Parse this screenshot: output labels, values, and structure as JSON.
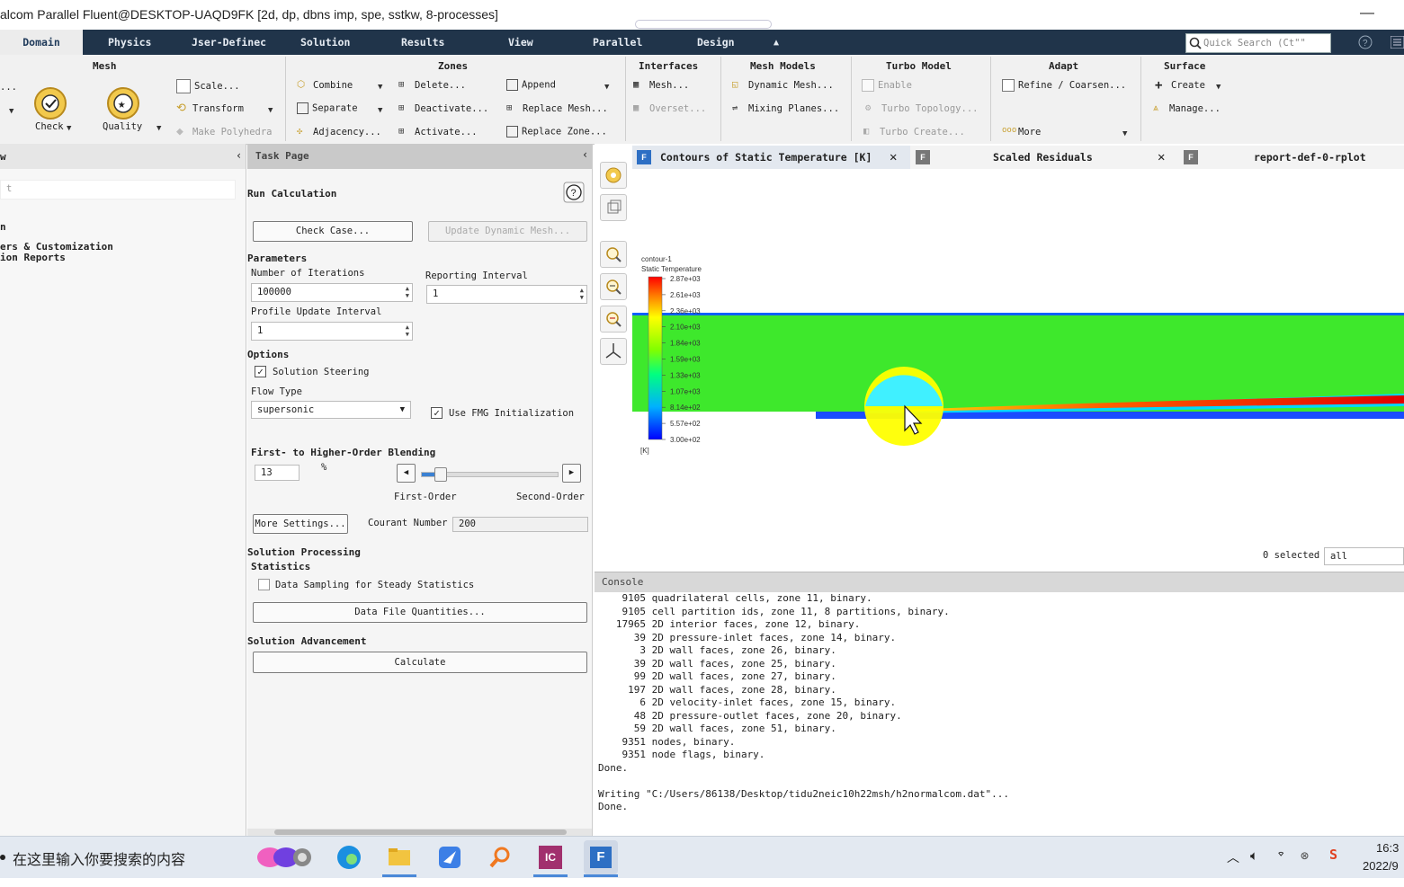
{
  "window": {
    "title": "alcom Parallel Fluent@DESKTOP-UAQD9FK  [2d, dp, dbns imp, spe, sstkw, 8-processes]",
    "minimize": "—"
  },
  "ribbon_tabs": [
    "Domain",
    "Physics",
    "Jser-Definec",
    "Solution",
    "Results",
    "View",
    "Parallel",
    "Design"
  ],
  "ribbon_collapse": "▲",
  "quick_search": {
    "placeholder": "Quick Search (Ct\"\""
  },
  "ribbon": {
    "mesh": {
      "title": "Mesh",
      "dots": "...",
      "check": "Check",
      "quality": "Quality",
      "scale": "Scale...",
      "transform": "Transform",
      "make_polyhedra": "Make Polyhedra"
    },
    "zones": {
      "title": "Zones",
      "combine": "Combine",
      "separate": "Separate",
      "adjacency": "Adjacency...",
      "delete": "Delete...",
      "deactivate": "Deactivate...",
      "activate": "Activate...",
      "append": "Append",
      "replace_mesh": "Replace Mesh...",
      "replace_zone": "Replace Zone..."
    },
    "interfaces": {
      "title": "Interfaces",
      "mesh": "Mesh...",
      "overset": "Overset..."
    },
    "mesh_models": {
      "title": "Mesh Models",
      "dynamic_mesh": "Dynamic Mesh...",
      "mixing_planes": "Mixing Planes..."
    },
    "turbo_model": {
      "title": "Turbo Model",
      "enable": "Enable",
      "turbo_topology": "Turbo Topology...",
      "turbo_create": "Turbo Create..."
    },
    "adapt": {
      "title": "Adapt",
      "refine": "Refine / Coarsen...",
      "more": "More"
    },
    "surface": {
      "title": "Surface",
      "create": "Create",
      "manage": "Manage..."
    }
  },
  "tree": {
    "header": "w",
    "filter": "t",
    "items": [
      "n",
      "ers & Customization",
      "ion Reports"
    ]
  },
  "task_page": {
    "header": "Task Page",
    "title": "Run Calculation",
    "check_case": "Check Case...",
    "update_dynamic_mesh": "Update Dynamic Mesh...",
    "parameters": "Parameters",
    "num_iterations_label": "Number of Iterations",
    "num_iterations": "100000",
    "reporting_interval_label": "Reporting Interval",
    "reporting_interval": "1",
    "profile_update_label": "Profile Update Interval",
    "profile_update": "1",
    "options": "Options",
    "solution_steering": "Solution Steering",
    "flow_type_label": "Flow Type",
    "flow_type": "supersonic",
    "use_fmg": "Use FMG Initialization",
    "blending_label": "First- to Higher-Order Blending",
    "blending_value": "13",
    "blending_percent": "%",
    "blending_fraction": 0.13,
    "first_order": "First-Order",
    "second_order": "Second-Order",
    "more_settings": "More Settings...",
    "courant_label": "Courant Number",
    "courant_value": "200",
    "solution_processing": "Solution Processing",
    "statistics": "Statistics",
    "data_sampling": "Data Sampling for Steady Statistics",
    "data_file_quantities": "Data File Quantities...",
    "solution_advancement": "Solution Advancement",
    "calculate": "Calculate"
  },
  "graphics": {
    "tabs": [
      {
        "label": "Contours of Static Temperature [K]",
        "close": "✕"
      },
      {
        "label": "Scaled Residuals",
        "close": "✕"
      },
      {
        "label": "report-def-0-rplot"
      }
    ],
    "contour_name": "contour-1",
    "variable": "Static Temperature",
    "unit": "[K]",
    "colormap_labels": [
      "2.87e+03",
      "2.61e+03",
      "2.36e+03",
      "2.10e+03",
      "1.84e+03",
      "1.59e+03",
      "1.33e+03",
      "1.07e+03",
      "8.14e+02",
      "5.57e+02",
      "3.00e+02"
    ],
    "selected_count": "0 selected",
    "selected_filter": "all"
  },
  "console": {
    "header": "Console",
    "lines": [
      "    9105 quadrilateral cells, zone 11, binary.",
      "    9105 cell partition ids, zone 11, 8 partitions, binary.",
      "   17965 2D interior faces, zone 12, binary.",
      "      39 2D pressure-inlet faces, zone 14, binary.",
      "       3 2D wall faces, zone 26, binary.",
      "      39 2D wall faces, zone 25, binary.",
      "      99 2D wall faces, zone 27, binary.",
      "     197 2D wall faces, zone 28, binary.",
      "       6 2D velocity-inlet faces, zone 15, binary.",
      "      48 2D pressure-outlet faces, zone 20, binary.",
      "      59 2D wall faces, zone 51, binary.",
      "    9351 nodes, binary.",
      "    9351 node flags, binary.",
      "Done.",
      "",
      "Writing \"C:/Users/86138/Desktop/tidu2neic10h22msh/h2normalcom.dat\"...",
      "Done."
    ]
  },
  "taskbar": {
    "search_placeholder": "在这里输入你要搜索的内容",
    "apps": [
      "edge",
      "file-explorer",
      "feishu",
      "search-tool",
      "intellij",
      "fluent"
    ],
    "app_fluent_letter": "F",
    "app_ic_letters": "IC",
    "time": "16:3",
    "date": "2022/9"
  }
}
